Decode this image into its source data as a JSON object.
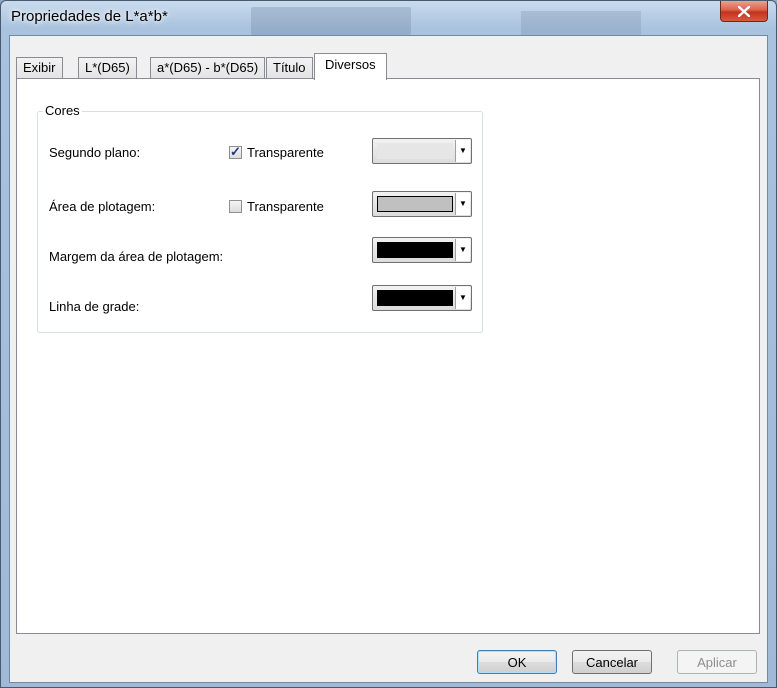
{
  "window": {
    "title": "Propriedades de L*a*b*",
    "close_label": "x"
  },
  "tabs": [
    {
      "label": "Exibir"
    },
    {
      "label": "L*(D65)"
    },
    {
      "label": "a*(D65) - b*(D65)"
    },
    {
      "label": "Título"
    },
    {
      "label": "Diversos",
      "active": true
    }
  ],
  "colors_group": {
    "label": "Cores",
    "rows": [
      {
        "label": "Segundo plano:",
        "checkbox_label": "Transparente",
        "checked": true,
        "swatch_color": "#e6e6e6"
      },
      {
        "label": "Área de plotagem:",
        "checkbox_label": "Transparente",
        "checked": false,
        "swatch_color": "#c0c0c0"
      },
      {
        "label": "Margem da área de plotagem:",
        "swatch_color": "#000000"
      },
      {
        "label": "Linha de grade:",
        "swatch_color": "#000000"
      }
    ],
    "dropdown_glyph": "▼",
    "check_glyph": "✓"
  },
  "buttons": {
    "ok": "OK",
    "cancel": "Cancelar",
    "apply": "Aplicar"
  }
}
